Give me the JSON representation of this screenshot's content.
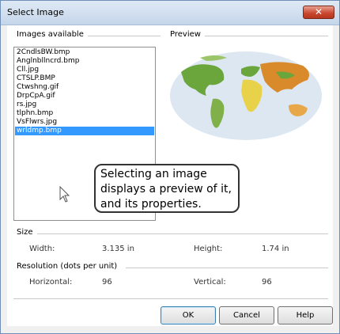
{
  "window": {
    "title": "Select Image",
    "close_symbol": "✕"
  },
  "images_group": {
    "label": "Images available",
    "files": [
      "2CndlsBW.bmp",
      "Anglnbllncrd.bmp",
      "Cll.jpg",
      "CTSLP.BMP",
      "Ctwshng.gif",
      "DrpCpA.gif",
      "rs.jpg",
      "tlphn.bmp",
      "VsFlwrs.jpg",
      "wrldmp.bmp"
    ],
    "selected": "wrldmp.bmp"
  },
  "preview_group": {
    "label": "Preview"
  },
  "callout": {
    "text": "Selecting an image displays a preview of it, and its properties."
  },
  "size_group": {
    "label": "Size",
    "width_label": "Width:",
    "width_value": "3.135 in",
    "height_label": "Height:",
    "height_value": "1.74 in"
  },
  "resolution_group": {
    "label": "Resolution (dots per unit)",
    "horizontal_label": "Horizontal:",
    "horizontal_value": "96",
    "vertical_label": "Vertical:",
    "vertical_value": "96"
  },
  "buttons": {
    "ok": "OK",
    "cancel": "Cancel",
    "help": "Help"
  },
  "colors": {
    "selection": "#3399ff",
    "ocean": "#dde7f2",
    "land_green": "#6aa63c",
    "land_yellow": "#e8d24a",
    "land_orange": "#d98a2b"
  }
}
